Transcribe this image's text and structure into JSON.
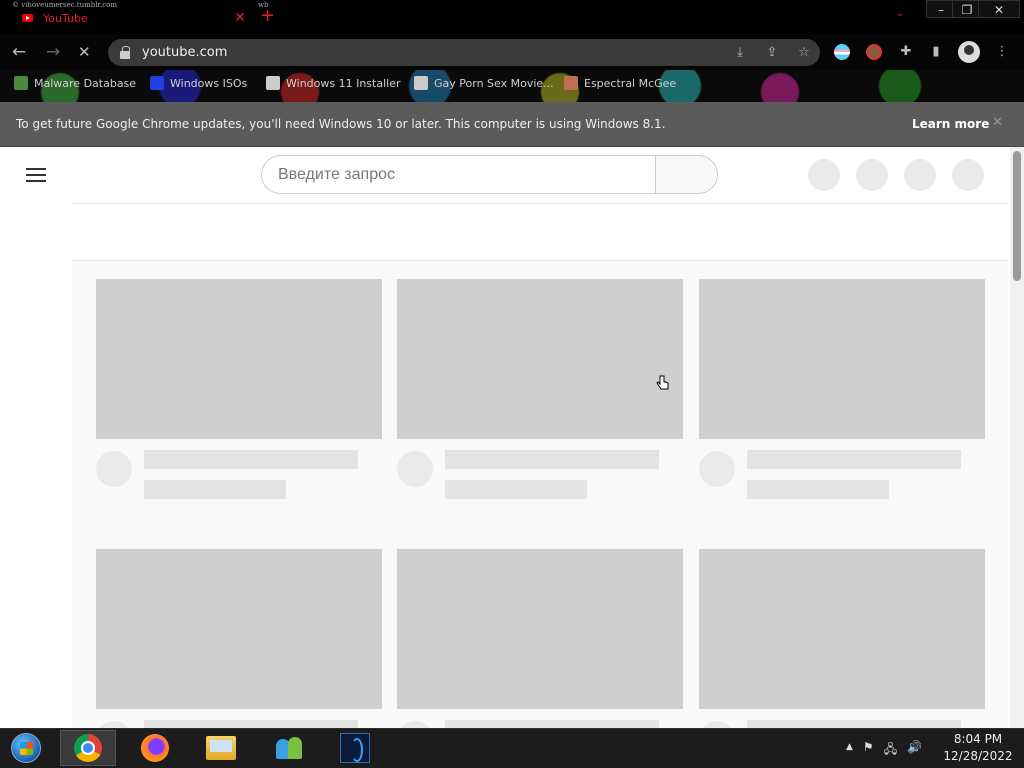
{
  "tab_strip": {
    "left_tiny_url": "© vihoveumersec.tumblr.com",
    "right_tiny_text": "wb",
    "active_tab": {
      "title": "YouTube",
      "favicon": "youtube-icon"
    },
    "new_tab_symbol": "+",
    "tab_search_symbol": "⌄",
    "window_controls": [
      "–",
      "❐",
      "✕"
    ]
  },
  "toolbar": {
    "back": "←",
    "forward": "→",
    "reload": "✕",
    "url": "youtube.com",
    "omnibox_icons": [
      "install-icon",
      "share-icon",
      "star-icon"
    ],
    "extensions": [
      "trans-flag-extension-icon",
      "face-extension-icon",
      "puzzle-icon",
      "sidepanel-icon"
    ],
    "menu_symbol": "⋮"
  },
  "bookmarks": [
    {
      "label": "Malware Database",
      "icon_color": "#4a8a3a"
    },
    {
      "label": "Windows ISOs",
      "icon_color": "#2040e0"
    },
    {
      "label": "Windows 11 Installer",
      "icon_color": "#cccccc"
    },
    {
      "label": "Gay Porn Sex Movie...",
      "icon_color": "#cccccc"
    },
    {
      "label": "Espectral McGee",
      "icon_color": "#c07050"
    }
  ],
  "infobar": {
    "message": "To get future Google Chrome updates, you'll need Windows 10 or later. This computer is using Windows 8.1.",
    "link": "Learn more",
    "close": "✕"
  },
  "youtube": {
    "search_placeholder": "Введите запрос"
  },
  "taskbar": {
    "apps": [
      "windows-start-orb",
      "chrome-icon",
      "firefox-icon",
      "file-explorer-icon",
      "people-icon",
      "blue-app-icon"
    ],
    "tray_symbols": [
      "▲",
      "⚑",
      "🖧",
      "🔊"
    ],
    "time": "8:04 PM",
    "date": "12/28/2022"
  }
}
